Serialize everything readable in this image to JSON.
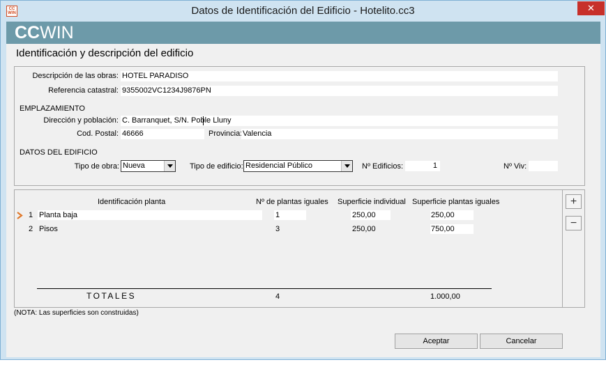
{
  "window": {
    "app_icon_text": "CC WIN",
    "title": "Datos de Identificación del Edificio - Hotelito.cc3",
    "close_glyph": "✕"
  },
  "banner": {
    "logo_bold": "CC",
    "logo_light": "WIN"
  },
  "page": {
    "heading": "Identificación y descripción del edificio"
  },
  "form": {
    "descripcion_label": "Descripción de las obras:",
    "descripcion_value": "HOTEL PARADISO",
    "referencia_label": "Referencia catastral:",
    "referencia_value": "9355002VC1234J9876PN",
    "emplazamiento_heading": "EMPLAZAMIENTO",
    "direccion_label": "Dirección y población:",
    "direccion_value": "C. Barranquet, S/N. Poble Lluny",
    "cp_label": "Cod. Postal:",
    "cp_value": "46666",
    "provincia_label": "Provincia:",
    "provincia_value": "Valencia",
    "datos_heading": "DATOS DEL EDIFICIO",
    "tipo_obra_label": "Tipo de obra:",
    "tipo_obra_value": "Nueva",
    "tipo_edificio_label": "Tipo de edificio:",
    "tipo_edificio_value": "Residencial Público",
    "n_edificios_label": "Nº Edificios:",
    "n_edificios_value": "1",
    "n_viv_label": "Nº Viv:",
    "n_viv_value": ""
  },
  "table": {
    "headers": [
      "Identificación planta",
      "Nº de plantas iguales",
      "Superficie individual",
      "Superficie plantas iguales"
    ],
    "rows": [
      {
        "num": "1",
        "name": "Planta baja",
        "count": "1",
        "surface": "250,00",
        "total": "250,00"
      },
      {
        "num": "2",
        "name": "Pisos",
        "count": "3",
        "surface": "250,00",
        "total": "750,00"
      }
    ],
    "totals_label": "TOTALES",
    "totals_count": "4",
    "totals_surface": "1.000,00",
    "add_glyph": "+",
    "remove_glyph": "−"
  },
  "note": "(NOTA: Las superficies son construidas)",
  "buttons": {
    "accept": "Aceptar",
    "cancel": "Cancelar"
  },
  "colors": {
    "title_bg": "#cfe3f1",
    "banner": "#6d9aa9",
    "close": "#c7302a",
    "arrow": "#e0782a"
  }
}
